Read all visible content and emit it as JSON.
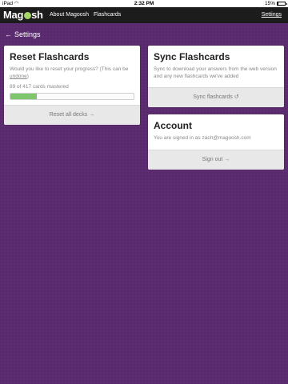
{
  "statusbar": {
    "device": "iPad",
    "wifi_icon": "wifi-icon",
    "time": "2:32 PM",
    "battery_percent": "15%",
    "battery_level": 0.15
  },
  "navbar": {
    "logo": {
      "text_left": "Mag",
      "text_right": "sh"
    },
    "links": [
      "About Magoosh",
      "Flashcards"
    ],
    "settings": "Settings"
  },
  "breadcrumb": {
    "arrow": "←",
    "label": "Settings"
  },
  "reset_card": {
    "title": "Reset Flashcards",
    "description": "Would you like to reset your progress? (This can be ",
    "description_link": "undone",
    "description_end": ")",
    "mastered_text": "89 of 417 cards mastered",
    "mastered": 89,
    "total": 417,
    "button": "Reset all decks →",
    "progress_color": "#7dc66b"
  },
  "sync_card": {
    "title": "Sync Flashcards",
    "description": "Sync to download your answers from the web version and any new flashcards we've added",
    "button": "Sync flashcards ↺"
  },
  "account_card": {
    "title": "Account",
    "description": "You are signed in as zach@magoosh.com",
    "button": "Sign out →"
  },
  "colors": {
    "background": "#5a2a6e",
    "navbar": "#1c1c1c",
    "accent_green": "#a5d56a"
  }
}
